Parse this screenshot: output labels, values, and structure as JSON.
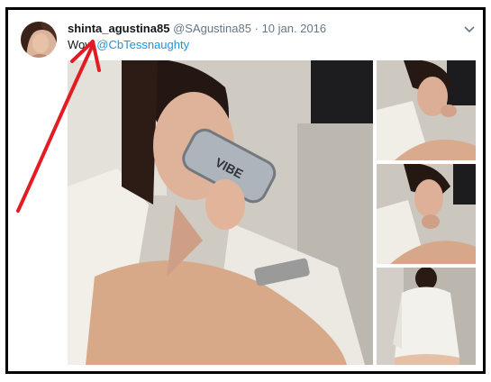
{
  "tweet": {
    "display_name": "shinta_agustina85",
    "handle": "@SAgustina85",
    "separator": "·",
    "date": "10 jan. 2016",
    "text_prefix": "Wow",
    "text_mention": "@CbTessnaughty"
  },
  "icons": {
    "menu": "chevron-down-icon",
    "annotation": "red-arrow-icon"
  },
  "media": {
    "photo_count": 4,
    "can_label": "VIBE"
  },
  "colors": {
    "border": "#000000",
    "link": "#1b95e0",
    "arrow": "#e31b23",
    "meta_text": "#657786"
  }
}
